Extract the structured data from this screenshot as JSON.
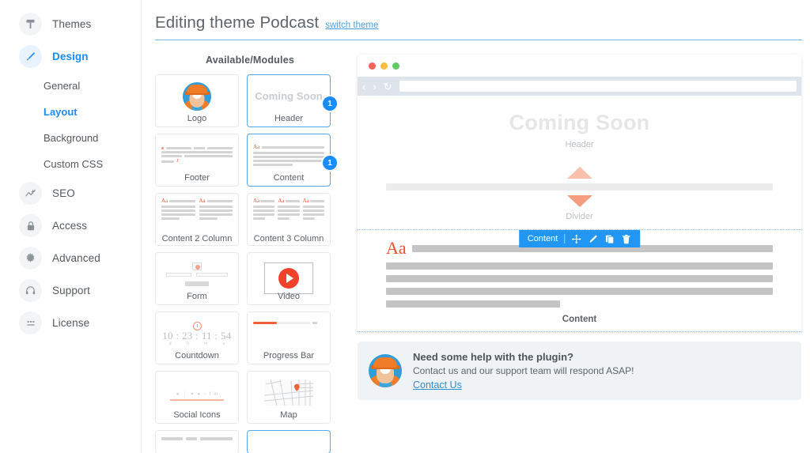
{
  "sidebar": {
    "items": [
      {
        "label": "Themes",
        "icon": "themes-icon",
        "active": false
      },
      {
        "label": "Design",
        "icon": "brush-icon",
        "active": true
      },
      {
        "label": "SEO",
        "icon": "seo-chart-icon",
        "active": false
      },
      {
        "label": "Access",
        "icon": "lock-icon",
        "active": false
      },
      {
        "label": "Advanced",
        "icon": "gear-icon",
        "active": false
      },
      {
        "label": "Support",
        "icon": "headset-icon",
        "active": false
      },
      {
        "label": "License",
        "icon": "dots-icon",
        "active": false
      }
    ],
    "design_subitems": [
      {
        "label": "General",
        "active": false
      },
      {
        "label": "Layout",
        "active": true
      },
      {
        "label": "Background",
        "active": false
      },
      {
        "label": "Custom CSS",
        "active": false
      }
    ]
  },
  "header": {
    "title": "Editing theme Podcast",
    "switch_link": "switch theme"
  },
  "modules": {
    "panel_title": "Available/Modules",
    "items": [
      {
        "name": "Logo",
        "thumb": "logo-avatar",
        "selected": false,
        "badge": null
      },
      {
        "name": "Header",
        "thumb": "coming-soon-text",
        "selected": true,
        "badge": "1",
        "thumb_text": "Coming Soon"
      },
      {
        "name": "Footer",
        "thumb": "footer-lines",
        "selected": false,
        "badge": null
      },
      {
        "name": "Content",
        "thumb": "content-lines",
        "selected": true,
        "badge": "1"
      },
      {
        "name": "Content 2 Column",
        "thumb": "content-2col",
        "selected": false,
        "badge": null
      },
      {
        "name": "Content 3 Column",
        "thumb": "content-3col",
        "selected": false,
        "badge": null
      },
      {
        "name": "Form",
        "thumb": "form-fields",
        "selected": false,
        "badge": null
      },
      {
        "name": "Video",
        "thumb": "video-play",
        "selected": false,
        "badge": null
      },
      {
        "name": "Countdown",
        "thumb": "countdown-timer",
        "selected": false,
        "badge": null,
        "countdown": "10 : 23 : 11 : 54",
        "units": [
          "d",
          "h",
          "m",
          "s"
        ]
      },
      {
        "name": "Progress Bar",
        "thumb": "progress-bar",
        "selected": false,
        "badge": null,
        "progress": 42
      },
      {
        "name": "Social Icons",
        "thumb": "social-icons",
        "selected": false,
        "badge": null
      },
      {
        "name": "Map",
        "thumb": "map-image",
        "selected": false,
        "badge": null
      }
    ]
  },
  "preview": {
    "browser": {
      "traffic_lights": [
        "#fc6058",
        "#fdbd40",
        "#5ecc62"
      ],
      "back_icon": "chevron-left-icon",
      "forward_icon": "chevron-right-icon",
      "reload_icon": "reload-icon",
      "url_value": ""
    },
    "sections": {
      "header": {
        "heading": "Coming Soon",
        "label": "Header"
      },
      "divider": {
        "label": "Divider"
      },
      "content": {
        "label": "Content",
        "aa_glyph": "Aa",
        "toolbar": {
          "title": "Content",
          "move_icon": "move-icon",
          "edit_icon": "pencil-icon",
          "duplicate_icon": "copy-icon",
          "delete_icon": "trash-icon"
        }
      }
    }
  },
  "help": {
    "title": "Need some help with the plugin?",
    "subtitle": "Contact us and our support team will respond ASAP!",
    "link": "Contact Us"
  },
  "colors": {
    "accent_blue": "#1a8cff",
    "toolbar_blue": "#2196f3",
    "orange": "#e8512e",
    "title_gray": "#5e6368"
  }
}
